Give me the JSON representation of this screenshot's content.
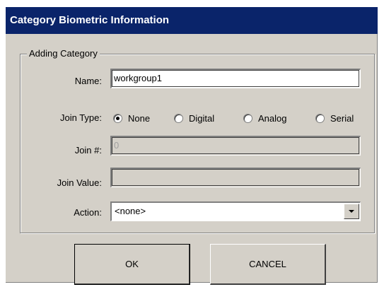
{
  "window": {
    "title": "Category Biometric Information"
  },
  "group": {
    "legend": "Adding Category"
  },
  "fields": {
    "name_label": "Name:",
    "name_value": "workgroup1",
    "join_type_label": "Join Type:",
    "join_number_label": "Join #:",
    "join_number_value": "0",
    "join_value_label": "Join Value:",
    "join_value_value": "",
    "action_label": "Action:",
    "action_value": "<none>"
  },
  "join_type_options": [
    {
      "label": "None",
      "checked": true
    },
    {
      "label": "Digital",
      "checked": false
    },
    {
      "label": "Analog",
      "checked": false
    },
    {
      "label": "Serial",
      "checked": false
    }
  ],
  "buttons": {
    "ok_label": "OK",
    "cancel_label": "CANCEL"
  },
  "colors": {
    "titlebar": "#0a246a",
    "face": "#d4d0c8"
  },
  "icons": {
    "dropdown": "chevron-down-icon"
  }
}
